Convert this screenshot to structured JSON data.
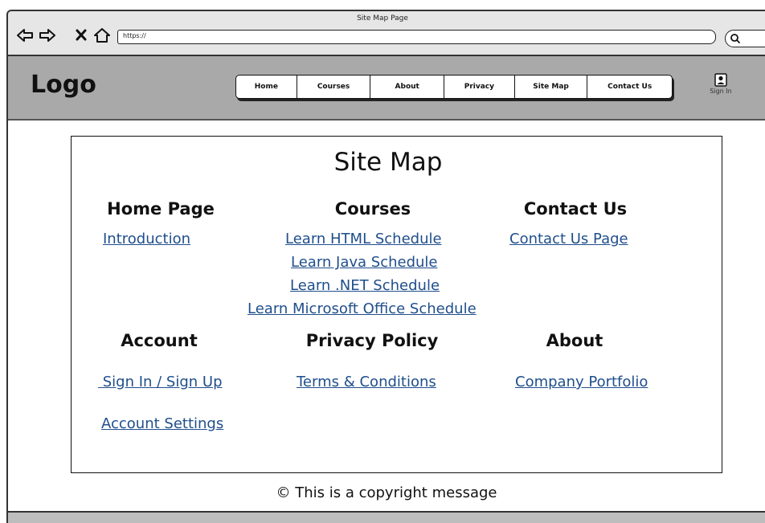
{
  "browser": {
    "window_title": "Site Map Page",
    "url": "https://"
  },
  "header": {
    "logo": "Logo",
    "nav": [
      "Home",
      "Courses",
      "About",
      "Privacy",
      "Site Map",
      "Contact Us"
    ],
    "sign_in_label": "Sign In"
  },
  "sitemap": {
    "title": "Site Map",
    "sections": {
      "home": {
        "heading": "Home Page",
        "links": [
          "Introduction"
        ]
      },
      "courses": {
        "heading": "Courses",
        "links": [
          "Learn HTML Schedule",
          "Learn Java Schedule",
          "Learn .NET Schedule",
          "Learn Microsoft Office Schedule"
        ]
      },
      "contact": {
        "heading": "Contact Us",
        "links": [
          "Contact Us Page"
        ]
      },
      "account": {
        "heading": "Account",
        "links": [
          " Sign In / Sign Up",
          "Account Settings"
        ]
      },
      "privacy": {
        "heading": "Privacy Policy",
        "links": [
          "Terms & Conditions"
        ]
      },
      "about": {
        "heading": "About",
        "links": [
          "Company Portfolio"
        ]
      }
    }
  },
  "footer": {
    "copyright": "© This is a copyright message"
  },
  "icons": {
    "back": "back-arrow-icon",
    "forward": "forward-arrow-icon",
    "close": "close-icon",
    "home": "home-icon",
    "search": "search-icon",
    "user": "user-icon"
  },
  "colors": {
    "header_bg": "#a9a9a9",
    "chrome_bg": "#e6e6e6",
    "link": "#1f4e8c"
  }
}
